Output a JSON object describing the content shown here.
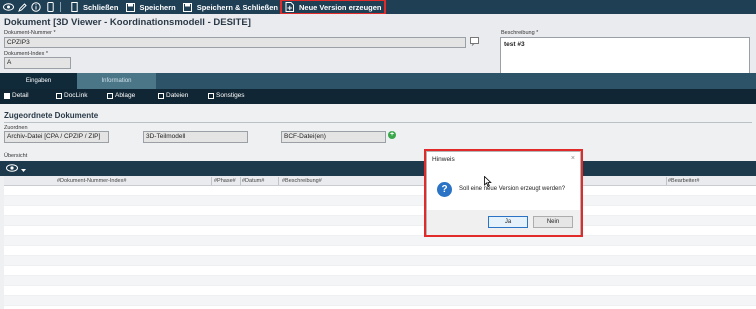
{
  "toolbar": {
    "icons": [
      "eye-icon",
      "edit-icon",
      "info-icon",
      "mobile-icon"
    ],
    "close_label": "Schließen",
    "save_label": "Speichern",
    "save_close_label": "Speichern & Schließen",
    "new_version_label": "Neue Version erzeugen",
    "highlight_color": "#e12a2a"
  },
  "document": {
    "title": "Dokument [3D Viewer - Koordinationsmodell - DESITE]",
    "number_label": "Dokument-Nummer *",
    "number_value": "CPZIP3",
    "index_label": "Dokument-Index *",
    "index_value": "A",
    "description_label": "Beschreibung *",
    "description_value": "test #3"
  },
  "tabs": [
    {
      "label": "Eingaben",
      "active": true
    },
    {
      "label": "Information",
      "active": false
    }
  ],
  "checks": [
    {
      "label": "Detail",
      "checked": true
    },
    {
      "label": "DocLink",
      "checked": false
    },
    {
      "label": "Ablage",
      "checked": false
    },
    {
      "label": "Dateien",
      "checked": false
    },
    {
      "label": "Sonstiges",
      "checked": false
    }
  ],
  "section": {
    "title": "Zugeordnete Dokumente",
    "assign_label": "Zuordnen",
    "assign_fields": [
      "Archiv-Datei [CPA / CPZIP / ZIP]",
      "3D-Teilmodell",
      "BCF-Datei(en)"
    ],
    "overview_label": "Übersicht"
  },
  "grid": {
    "columns": [
      "#Dokument-Nummer-Index#",
      "#Phase#",
      "#Datum#",
      "#Beschreibung#",
      "#Bearbeiter#"
    ]
  },
  "dialog": {
    "title": "Hinweis",
    "message": "Soll eine neue Version erzeugt werden?",
    "yes_label": "Ja",
    "no_label": "Nein",
    "close_glyph": "×",
    "icon": "question-icon"
  },
  "colors": {
    "toolbar_bg": "#1f3f55",
    "tab_bar_bg": "#2c5367",
    "accent_red": "#e12a2a",
    "dialog_icon_blue": "#2a73c5"
  }
}
